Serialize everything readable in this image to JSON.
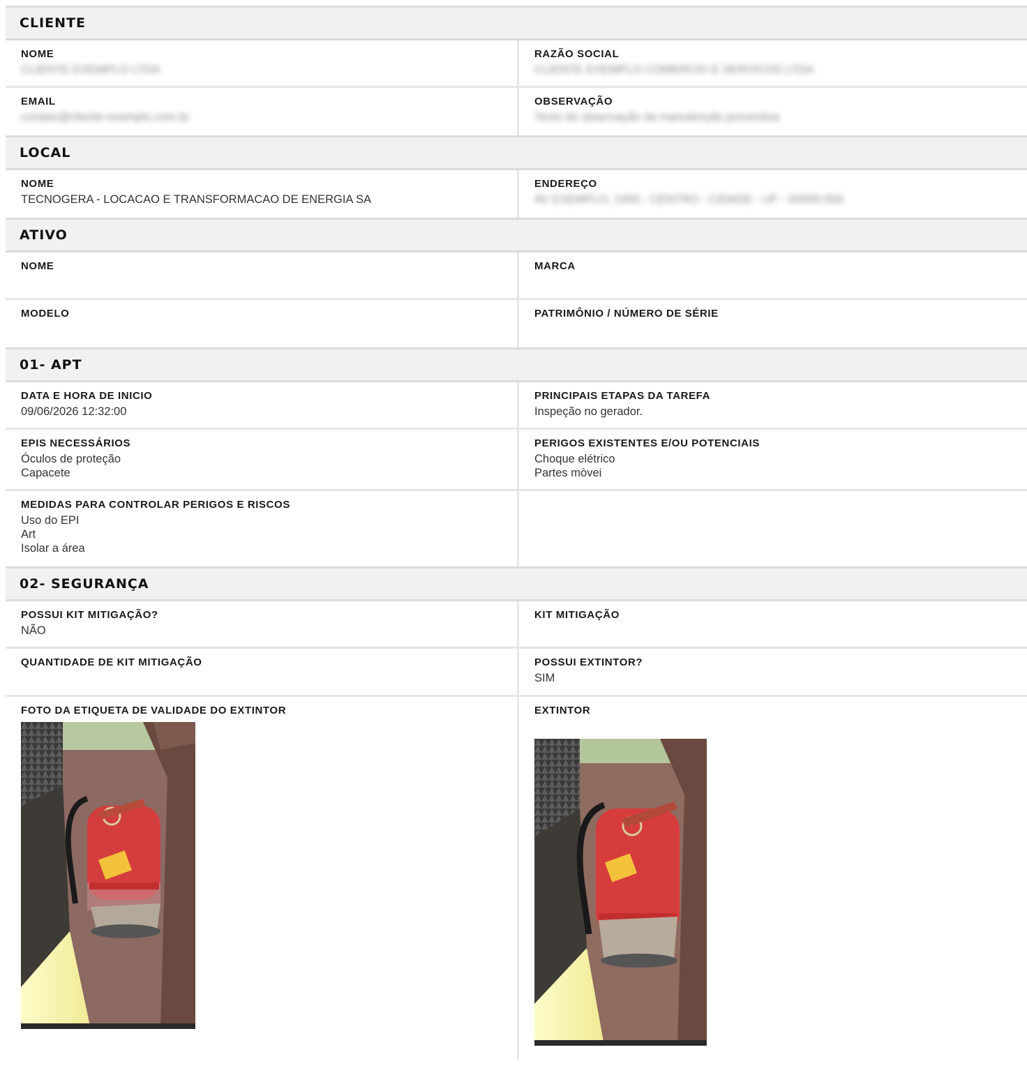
{
  "cliente": {
    "title": "CLIENTE",
    "nome_label": "NOME",
    "nome_value": "CLIENTE EXEMPLO LTDA",
    "razao_label": "RAZÃO SOCIAL",
    "razao_value": "CLIENTE EXEMPLO COMERCIO E SERVICOS LTDA",
    "email_label": "EMAIL",
    "email_value": "contato@cliente-exemplo.com.br",
    "observacao_label": "OBSERVAÇÃO",
    "observacao_value": "Texto de observação da manutenção preventiva"
  },
  "local": {
    "title": "LOCAL",
    "nome_label": "NOME",
    "nome_value": "TECNOGERA - LOCACAO E TRANSFORMACAO DE ENERGIA SA",
    "endereco_label": "ENDEREÇO",
    "endereco_value": "AV EXEMPLO, 1000 - CENTRO - CIDADE - UF - 00000-000"
  },
  "ativo": {
    "title": "ATIVO",
    "nome_label": "NOME",
    "nome_value": "",
    "marca_label": "MARCA",
    "marca_value": "",
    "modelo_label": "MODELO",
    "modelo_value": "",
    "patrimonio_label": "PATRIMÔNIO / NÚMERO DE SÉRIE",
    "patrimonio_value": ""
  },
  "apt": {
    "title": "01- APT",
    "inicio_label": "DATA E HORA DE INICIO",
    "inicio_value": "09/06/2026 12:32:00",
    "etapas_label": "PRINCIPAIS ETAPAS DA TAREFA",
    "etapas_value": "Inspeção no gerador.",
    "epis_label": "EPIS NECESSÁRIOS",
    "epis_values": [
      "Óculos de proteção",
      "Capacete"
    ],
    "perigos_label": "PERIGOS EXISTENTES E/OU POTENCIAIS",
    "perigos_values": [
      "Choque elétrico",
      "Partes mòvei"
    ],
    "medidas_label": "MEDIDAS PARA CONTROLAR PERIGOS E RISCOS",
    "medidas_values": [
      "Uso do EPI",
      "Art",
      "Isolar a área"
    ]
  },
  "seguranca": {
    "title": "02- SEGURANÇA",
    "possui_kit_label": "POSSUI KIT MITIGAÇÃO?",
    "possui_kit_value": "NÃO",
    "kit_label": "KIT MITIGAÇÃO",
    "kit_value": "",
    "qtd_kit_label": "QUANTIDADE DE KIT MITIGAÇÃO",
    "qtd_kit_value": "",
    "possui_extintor_label": "POSSUI EXTINTOR?",
    "possui_extintor_value": "SIM",
    "foto_label": "FOTO DA ETIQUETA DE VALIDADE DO EXTINTOR",
    "extintor_label": "EXTINTOR"
  }
}
